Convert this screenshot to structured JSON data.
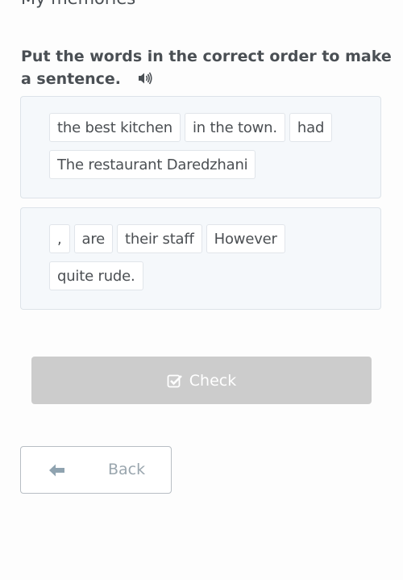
{
  "header": {
    "title": "My memories"
  },
  "exercise": {
    "instruction": "Put the words in the correct order to make a sentence.",
    "audio_icon": "speaker-icon",
    "sentences": [
      {
        "chips": [
          "the best kitchen",
          "in the town.",
          "had",
          "The restaurant Daredzhani"
        ]
      },
      {
        "chips": [
          ",",
          "are",
          "their staff",
          "However",
          "quite rude."
        ]
      }
    ]
  },
  "actions": {
    "check_label": "Check",
    "check_icon": "checkbox-icon",
    "back_label": "Back",
    "back_icon": "arrow-left-icon"
  },
  "colors": {
    "check_disabled_bg": "#cccccc",
    "back_text": "#9aa6ae",
    "box_bg": "#f5f8fb"
  }
}
